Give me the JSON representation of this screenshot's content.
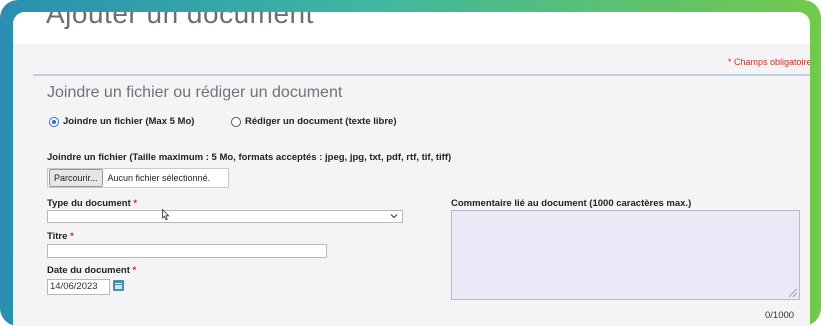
{
  "page": {
    "title": "Ajouter un document",
    "required_note": "* Champs obligatoires",
    "section_title": "Joindre un fichier ou rédiger un document"
  },
  "mode": {
    "options": [
      {
        "label": "Joindre un fichier (Max 5 Mo)",
        "selected": true
      },
      {
        "label": "Rédiger un document (texte libre)",
        "selected": false
      }
    ]
  },
  "file_upload": {
    "label": "Joindre un fichier (Taille maximum : 5 Mo, formats acceptés : jpeg, jpg, txt, pdf, rtf, tif, tiff)",
    "browse_label": "Parcourir...",
    "status": "Aucun fichier sélectionné."
  },
  "form": {
    "type_label": "Type du document",
    "type_value": "",
    "title_label": "Titre",
    "title_value": "",
    "date_label": "Date du document",
    "date_value": "14/06/2023",
    "required_marker": "*",
    "comment_label": "Commentaire lié au document (1000 caractères max.)",
    "comment_value": "",
    "comment_counter": "0/1000"
  },
  "colors": {
    "accent": "#2b6fc0",
    "required": "#c8322a",
    "frame_start": "#2a8fb0",
    "frame_end": "#72c94a"
  },
  "icons": [
    "chevron-down-icon",
    "calendar-icon",
    "resize-handle-icon",
    "mouse-cursor-icon"
  ]
}
